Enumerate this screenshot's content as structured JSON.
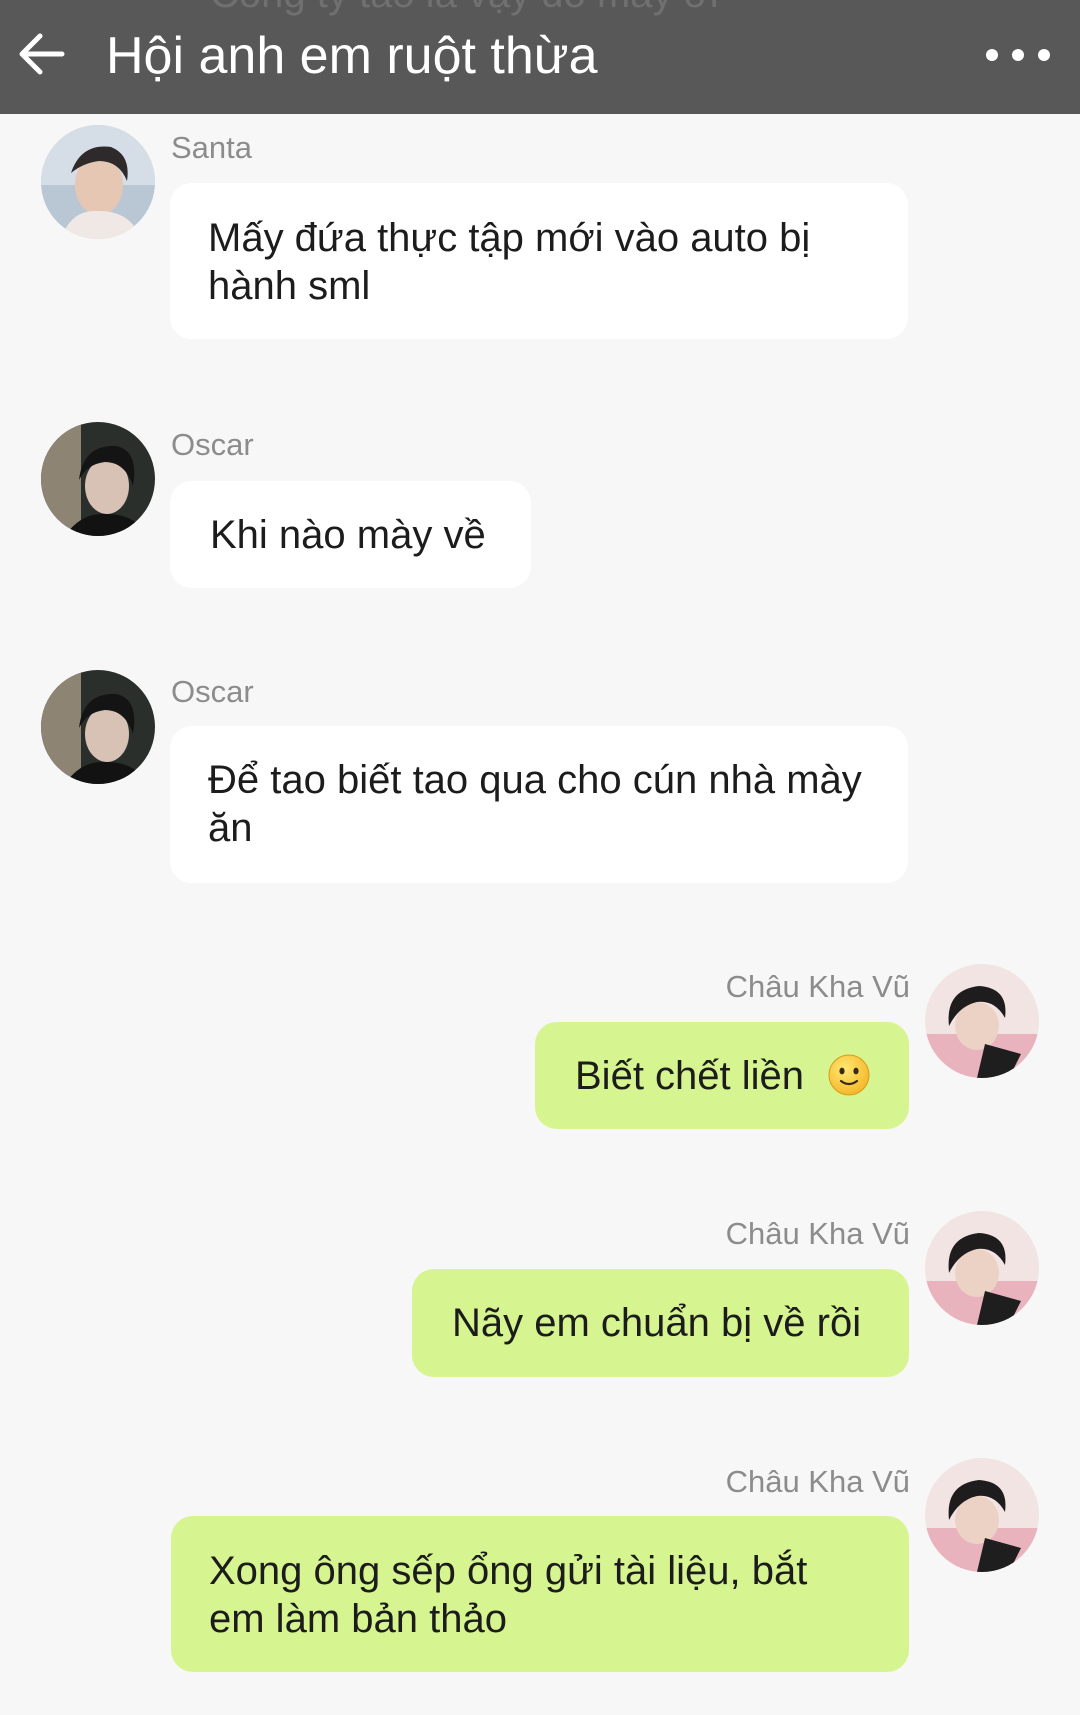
{
  "header": {
    "title": "Hội anh em ruột thừa",
    "ghost_text": "Công ty tao là vậy đó mày ơi",
    "back_icon": "arrow-left-icon",
    "more_icon": "more-dots-icon",
    "background": "#585858"
  },
  "messages": [
    {
      "sender": "Santa",
      "text": "Mấy đứa thực tập mới vào auto bị hành sml",
      "direction": "incoming"
    },
    {
      "sender": "Oscar",
      "text": "Khi nào mày về",
      "direction": "incoming"
    },
    {
      "sender": "Oscar",
      "text": "Để tao biết tao qua cho cún nhà mày ăn",
      "direction": "incoming"
    },
    {
      "sender": "Châu Kha Vũ",
      "text": "Biết chết liền",
      "emoji": "slightly-smiling-face-icon",
      "direction": "outgoing"
    },
    {
      "sender": "Châu Kha Vũ",
      "text": "Nãy em chuẩn bị về rồi",
      "direction": "outgoing"
    },
    {
      "sender": "Châu Kha Vũ",
      "text": "Xong ông sếp ổng gửi tài liệu, bắt em làm bản thảo",
      "direction": "outgoing"
    }
  ],
  "colors": {
    "incoming_bubble": "#ffffff",
    "outgoing_bubble": "#d6f590",
    "background": "#f7f7f7"
  }
}
